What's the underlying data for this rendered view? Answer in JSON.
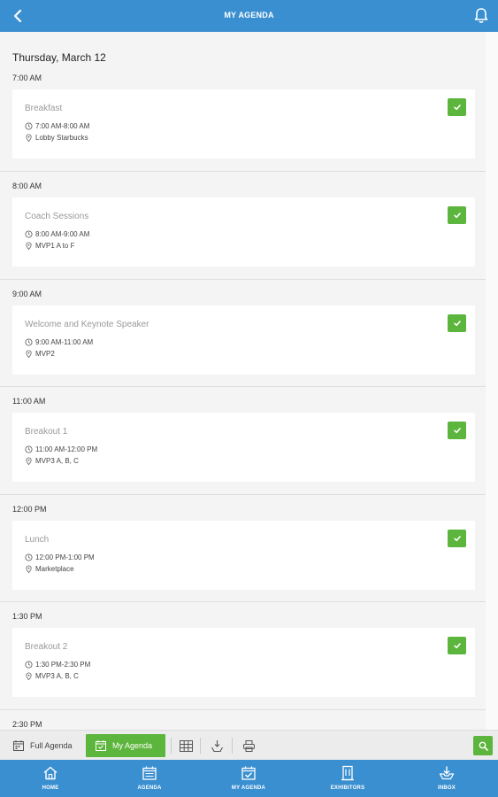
{
  "header": {
    "title": "MY AGENDA",
    "back_icon": "chevron-left-icon",
    "notify_icon": "bell-icon",
    "color": "#3a8fd0"
  },
  "agenda": {
    "date": "Thursday, March 12",
    "slots": [
      {
        "time": "7:00 AM",
        "title": "Breakfast",
        "range": "7:00 AM-8:00 AM",
        "location": "Lobby Starbucks",
        "selected": true
      },
      {
        "time": "8:00 AM",
        "title": "Coach Sessions",
        "range": "8:00 AM-9:00 AM",
        "location": "MVP1 A to F",
        "selected": true
      },
      {
        "time": "9:00 AM",
        "title": "Welcome and Keynote Speaker",
        "range": "9:00 AM-11:00 AM",
        "location": "MVP2",
        "selected": true
      },
      {
        "time": "11:00 AM",
        "title": "Breakout 1",
        "range": "11:00 AM-12:00 PM",
        "location": "MVP3 A, B, C",
        "selected": true
      },
      {
        "time": "12:00 PM",
        "title": "Lunch",
        "range": "12:00 PM-1:00 PM",
        "location": "Marketplace",
        "selected": true
      },
      {
        "time": "1:30 PM",
        "title": "Breakout 2",
        "range": "1:30 PM-2:30 PM",
        "location": "MVP3 A, B, C",
        "selected": true
      },
      {
        "time": "2:30 PM"
      }
    ]
  },
  "toolbar": {
    "full_agenda": "Full Agenda",
    "my_agenda": "My Agenda",
    "icons": [
      "grid-icon",
      "sort-icon",
      "print-icon",
      "search-icon"
    ],
    "accent": "#5cb53c"
  },
  "bottom_nav": [
    {
      "label": "HOME",
      "icon": "home-icon"
    },
    {
      "label": "AGENDA",
      "icon": "calendar-icon"
    },
    {
      "label": "MY AGENDA",
      "icon": "calendar-check-icon"
    },
    {
      "label": "EXHIBITORS",
      "icon": "building-icon"
    },
    {
      "label": "INBOX",
      "icon": "inbox-icon"
    }
  ]
}
